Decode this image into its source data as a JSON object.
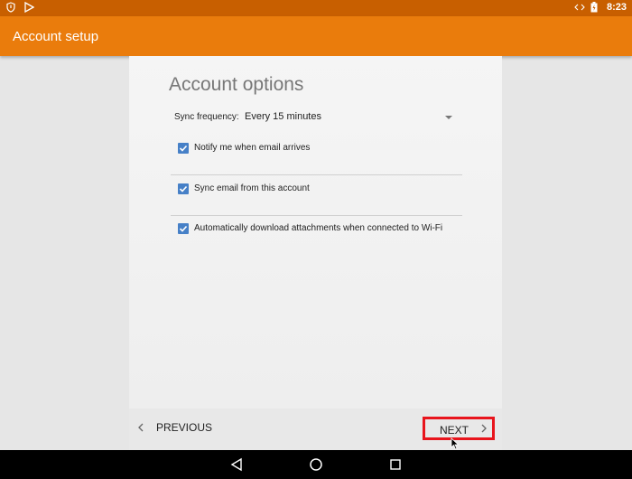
{
  "status_bar": {
    "time": "8:23",
    "icons_left": [
      "shield-icon",
      "play-store-icon"
    ],
    "icons_right": [
      "code-icon",
      "battery-charging-icon"
    ]
  },
  "app_bar": {
    "title": "Account setup"
  },
  "page": {
    "heading": "Account options",
    "sync": {
      "label": "Sync frequency:",
      "value": "Every 15 minutes"
    },
    "options": [
      {
        "label": "Notify me when email arrives",
        "checked": true
      },
      {
        "label": "Sync email from this account",
        "checked": true
      },
      {
        "label": "Automatically download attachments when connected to Wi-Fi",
        "checked": true
      }
    ]
  },
  "buttons": {
    "previous": "PREVIOUS",
    "next": "NEXT"
  },
  "colors": {
    "status_bar": "#c85f00",
    "app_bar": "#ea7c0c",
    "checkbox": "#4680c7",
    "highlight": "#e8141c"
  },
  "nav_bar": {
    "icons": [
      "back-icon",
      "home-icon",
      "recents-icon"
    ]
  }
}
